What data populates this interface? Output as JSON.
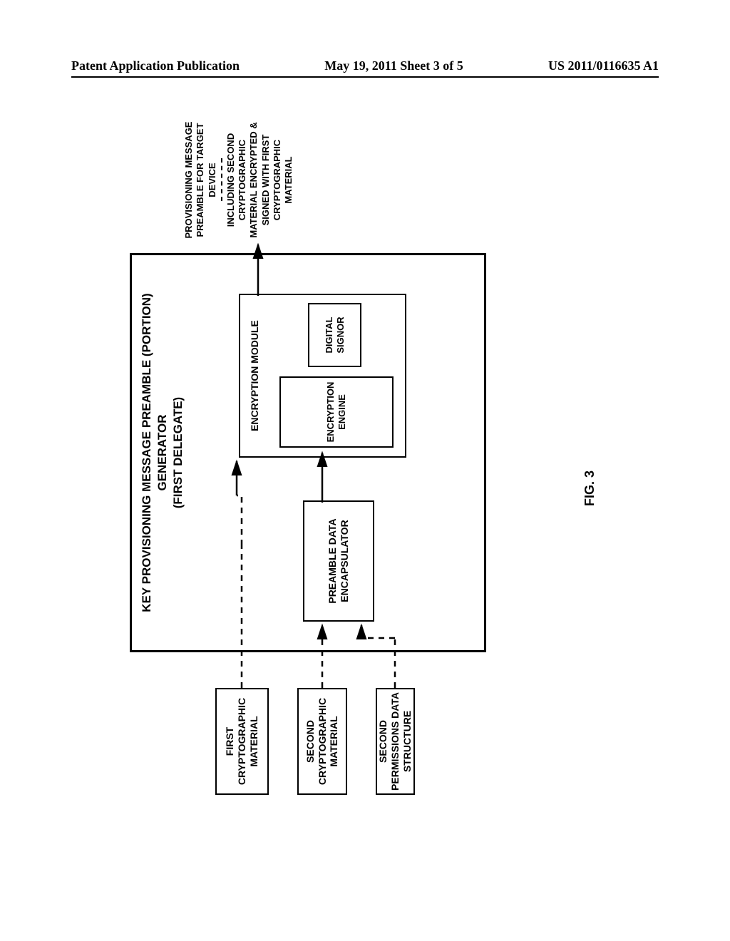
{
  "header": {
    "left": "Patent Application Publication",
    "center": "May 19, 2011  Sheet 3 of 5",
    "right": "US 2011/0116635 A1"
  },
  "diagram": {
    "main_title_line1": "KEY PROVISIONING MESSAGE PREAMBLE (PORTION)",
    "main_title_line2": "GENERATOR",
    "main_title_line3": "(FIRST DELEGATE)",
    "preamble_box": "PREAMBLE DATA ENCAPSULATOR",
    "enc_module_title": "ENCRYPTION MODULE",
    "enc_engine": "ENCRYPTION ENGINE",
    "dig_signor": "DIGITAL SIGNOR",
    "first_crypto": "FIRST CRYPTOGRAPHIC MATERIAL",
    "second_crypto": "SECOND CRYPTOGRAPHIC MATERIAL",
    "second_perm": "SECOND PERMISSIONS DATA STRUCTURE",
    "output_line1": "PROVISIONING MESSAGE PREAMBLE FOR TARGET DEVICE",
    "output_line2": "INCLUDING SECOND CRYPTOGRAPHIC MATERIAL ENCRYPTED & SIGNED WITH FIRST CRYPTOGRAPHIC MATERIAL"
  },
  "figure_label": "FIG. 3"
}
